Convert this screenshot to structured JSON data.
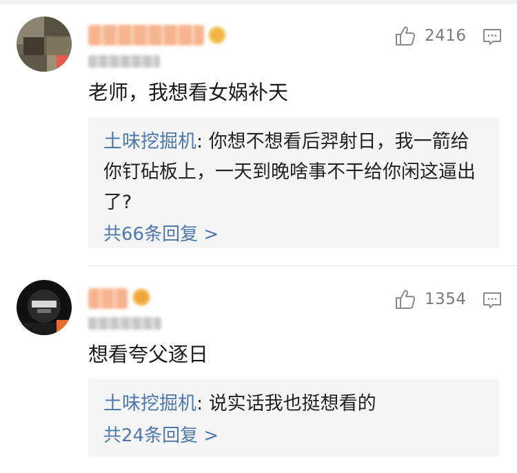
{
  "colors": {
    "link": "#4d78ad",
    "text": "#1a1a1a",
    "muted": "#7a7a7a",
    "reply_bg": "#f5f5f5",
    "blur_name": "#f4b189"
  },
  "comments": [
    {
      "like_count": "2416",
      "text": "老师，我想看女娲补天",
      "reply": {
        "author": "土味挖掘机",
        "separator": ": ",
        "text": "你想不想看后羿射日，我一箭给你钉砧板上，一天到晚啥事不干给你闲这逼出了?",
        "more": "共66条回复 >"
      },
      "icons": [
        "avatar-blurred",
        "crown-badge-icon",
        "thumbs-up-icon",
        "comment-icon"
      ]
    },
    {
      "like_count": "1354",
      "text": "想看夸父逐日",
      "reply": {
        "author": "土味挖掘机",
        "separator": ": ",
        "text": "说实话我也挺想看的",
        "more": "共24条回复 >"
      },
      "icons": [
        "avatar-blurred",
        "crown-badge-icon",
        "thumbs-up-icon",
        "comment-icon"
      ]
    }
  ]
}
